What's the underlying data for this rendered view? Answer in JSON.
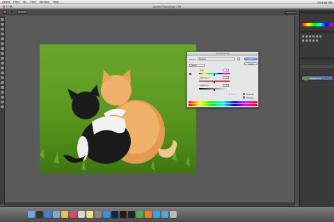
{
  "menubar": {
    "items": [
      "Select",
      "Filter",
      "3D",
      "View",
      "Window",
      "Help"
    ],
    "clock": "Fri 4:48 PM"
  },
  "window": {
    "title": "Adobe Photoshop CS6"
  },
  "dialog": {
    "title": "Hue/Saturation",
    "preset_label": "Preset:",
    "preset_value": "Default",
    "channel_value": "Master",
    "hue_label": "Hue:",
    "hue_value": "0",
    "saturation_label": "Saturation:",
    "saturation_value": "0",
    "lightness_label": "Lightness:",
    "lightness_value": "0",
    "ok_label": "OK",
    "cancel_label": "Cancel",
    "colorize_label": "Colorize",
    "preview_label": "Preview",
    "preview_checked": true,
    "colorize_checked": false
  },
  "layers": {
    "background_label": "Background"
  },
  "colors": {
    "accent": "#4a8ee8",
    "workspace": "#5a5a5a",
    "grass": "#5e9b22"
  },
  "dock": {
    "apps": [
      "finder-icon",
      "dashboard-icon",
      "safari-icon",
      "mail-icon",
      "photos-icon",
      "itunes-icon",
      "calendar-icon",
      "notes-icon",
      "preferences-icon",
      "appstore-icon",
      "photoshop-icon",
      "bridge-icon",
      "terminal-icon",
      "chrome-icon",
      "vlc-icon",
      "skype-icon",
      "folder-icon",
      "trash-icon"
    ]
  }
}
